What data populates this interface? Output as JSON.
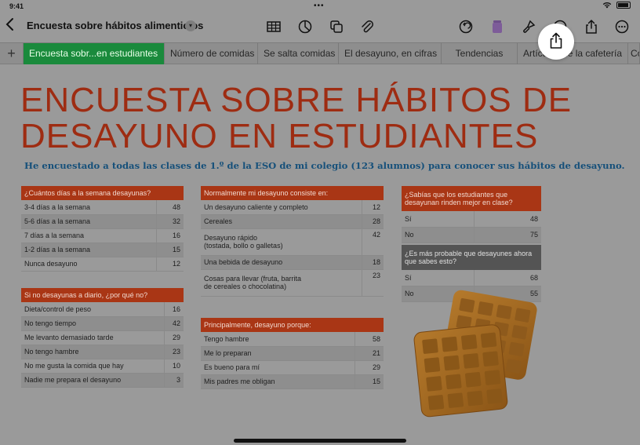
{
  "status": {
    "time": "9:41",
    "dots": "•••"
  },
  "toolbar": {
    "doc_title": "Encuesta sobre hábitos alimenticios",
    "icons": [
      "back-icon",
      "table-icon",
      "chart-icon",
      "shapes-icon",
      "attachment-icon",
      "undo-icon",
      "format-icon",
      "brush-icon",
      "collaborate-icon",
      "share-icon",
      "more-icon"
    ]
  },
  "tabs": {
    "add": "+",
    "items": [
      {
        "label": "Encuesta sobr...en estudiantes"
      },
      {
        "label": "Número de comidas"
      },
      {
        "label": "Se salta comidas"
      },
      {
        "label": "El desayuno, en cifras"
      },
      {
        "label": "Tendencias"
      },
      {
        "label": "Artículos de la cafetería"
      },
      {
        "label": "Co"
      }
    ]
  },
  "sheet": {
    "title_line1": "ENCUESTA SOBRE HÁBITOS DE",
    "title_line2": "DESAYUNO EN ESTUDIANTES",
    "subtitle": "He encuestado a todas las clases de 1.º de la ESO de mi colegio (123 alumnos) para conocer sus hábitos de desayuno.",
    "table1": {
      "header": "¿Cuántos días a la semana desayunas?",
      "rows": [
        {
          "label": "3-4 días a la semana",
          "value": "48"
        },
        {
          "label": "5-6 días a la semana",
          "value": "32"
        },
        {
          "label": "7 días a la semana",
          "value": "16"
        },
        {
          "label": "1-2 días a la semana",
          "value": "15"
        },
        {
          "label": "Nunca desayuno",
          "value": "12"
        }
      ]
    },
    "table2": {
      "header": "Si no desayunas a diario, ¿por qué no?",
      "rows": [
        {
          "label": "Dieta/control de peso",
          "value": "16"
        },
        {
          "label": "No tengo tiempo",
          "value": "42"
        },
        {
          "label": "Me levanto demasiado tarde",
          "value": "29"
        },
        {
          "label": "No tengo hambre",
          "value": "23"
        },
        {
          "label": "No me gusta la comida que hay",
          "value": "10"
        },
        {
          "label": "Nadie me prepara el desayuno",
          "value": "3"
        }
      ]
    },
    "table3": {
      "header": "Normalmente mi desayuno consiste en:",
      "rows": [
        {
          "label": "Un desayuno caliente y completo",
          "value": "12"
        },
        {
          "label": "Cereales",
          "value": "28"
        },
        {
          "label": "Desayuno rápido\n(tostada, bollo o galletas)",
          "value": "42"
        },
        {
          "label": "Una bebida de desayuno",
          "value": "18"
        },
        {
          "label": "Cosas para llevar (fruta, barrita\nde cereales o chocolatina)",
          "value": "23"
        }
      ]
    },
    "table4": {
      "header": "Principalmente, desayuno porque:",
      "rows": [
        {
          "label": "Tengo hambre",
          "value": "58"
        },
        {
          "label": "Me lo preparan",
          "value": "21"
        },
        {
          "label": "Es bueno para mí",
          "value": "29"
        },
        {
          "label": "Mis padres me obligan",
          "value": "15"
        }
      ]
    },
    "table5": {
      "header": "¿Sabías que los estudiantes que desayunan rinden mejor en clase?",
      "rows": [
        {
          "label": "Sí",
          "value": "48"
        },
        {
          "label": "No",
          "value": "75"
        }
      ]
    },
    "table6": {
      "header": "¿Es más probable que desayunes ahora que sabes esto?",
      "rows": [
        {
          "label": "Sí",
          "value": "68"
        },
        {
          "label": "No",
          "value": "55"
        }
      ]
    }
  },
  "colors": {
    "title": "#9e2c12",
    "subtitle": "#16507a",
    "header_red": "#a93615",
    "header_gray": "#545454",
    "active_tab": "#1a8a3c"
  }
}
